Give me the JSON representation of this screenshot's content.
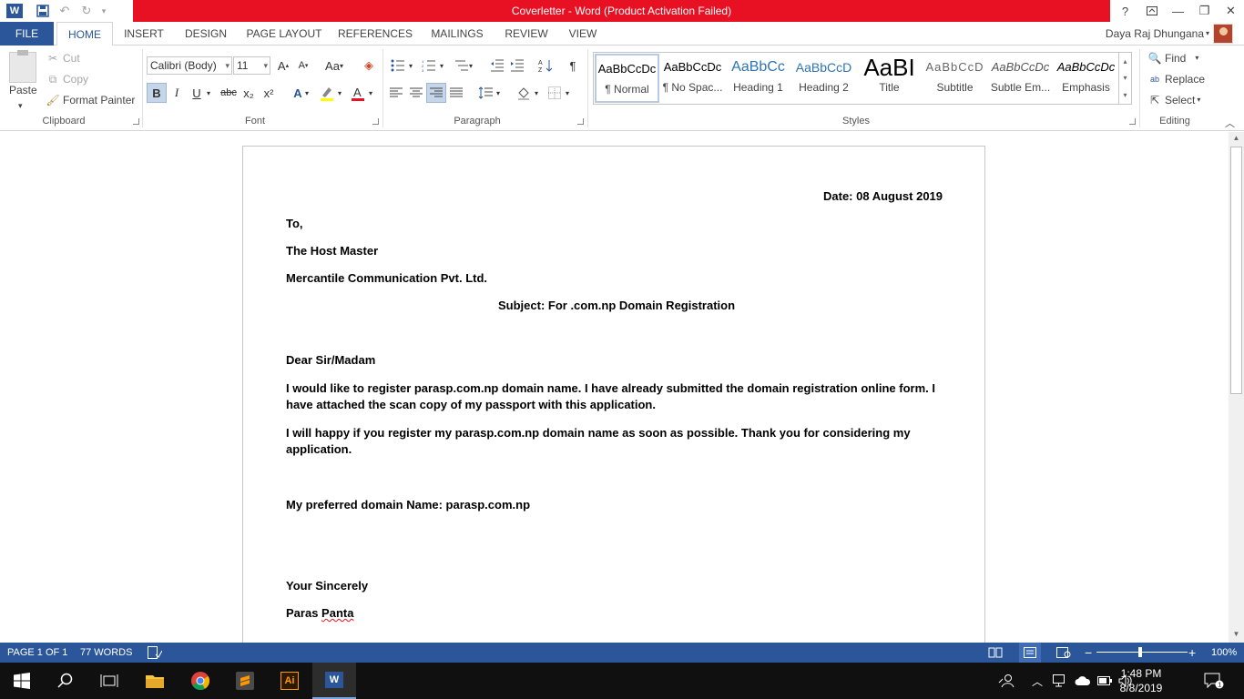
{
  "window": {
    "title": "Coverletter -  Word (Product Activation Failed)",
    "help": "?",
    "accent": "#2b579a",
    "alert_color": "#e81123"
  },
  "tabs": [
    "FILE",
    "HOME",
    "INSERT",
    "DESIGN",
    "PAGE LAYOUT",
    "REFERENCES",
    "MAILINGS",
    "REVIEW",
    "VIEW"
  ],
  "active_tab": "HOME",
  "user": {
    "name": "Daya Raj Dhungana"
  },
  "clipboard": {
    "paste": "Paste",
    "cut": "Cut",
    "copy": "Copy",
    "format_painter": "Format Painter",
    "label": "Clipboard"
  },
  "font": {
    "name": "Calibri (Body)",
    "size": "11",
    "label": "Font",
    "bold": "B",
    "italic": "I",
    "underline": "U",
    "strike": "abc",
    "subscript": "x₂",
    "superscript": "x²",
    "grow": "A",
    "shrink": "A",
    "change_case": "Aa"
  },
  "paragraph": {
    "label": "Paragraph"
  },
  "styles": {
    "label": "Styles",
    "items": [
      {
        "sample": "AaBbCcDc",
        "name": "¶ Normal"
      },
      {
        "sample": "AaBbCcDc",
        "name": "¶ No Spac..."
      },
      {
        "sample": "AaBbCc",
        "name": "Heading 1"
      },
      {
        "sample": "AaBbCcD",
        "name": "Heading 2"
      },
      {
        "sample": "AaBI",
        "name": "Title"
      },
      {
        "sample": "AaBbCcD",
        "name": "Subtitle"
      },
      {
        "sample": "AaBbCcDc",
        "name": "Subtle Em..."
      },
      {
        "sample": "AaBbCcDc",
        "name": "Emphasis"
      }
    ]
  },
  "editing": {
    "label": "Editing",
    "find": "Find",
    "replace": "Replace",
    "select": "Select"
  },
  "document": {
    "date": "Date: 08 August 2019",
    "to": "To,",
    "recipient": "The Host Master",
    "company": "Mercantile Communication Pvt. Ltd.",
    "subject": "Subject: For .com.np Domain Registration",
    "salutation": "Dear Sir/Madam",
    "para1": "I would like to register parasp.com.np domain name. I have already submitted the domain registration online form. I have attached the scan copy of my passport with this application.",
    "para2": "I will happy if you register my parasp.com.np domain name as soon as possible. Thank you for considering my application.",
    "preferred": "My preferred domain Name: parasp.com.np",
    "closing": "Your Sincerely",
    "signature_first": "Paras",
    "signature_last": "Panta"
  },
  "status": {
    "page": "PAGE 1 OF 1",
    "words": "77 WORDS",
    "zoom": "100%",
    "zoom_level": 1.0
  },
  "taskbar": {
    "time": "1:48 PM",
    "date": "8/8/2019",
    "notifications": "1",
    "apps": [
      "start-icon",
      "search-icon",
      "task-view-icon",
      "file-explorer-icon",
      "chrome-icon",
      "sublime-icon",
      "illustrator-icon",
      "word-icon"
    ]
  }
}
